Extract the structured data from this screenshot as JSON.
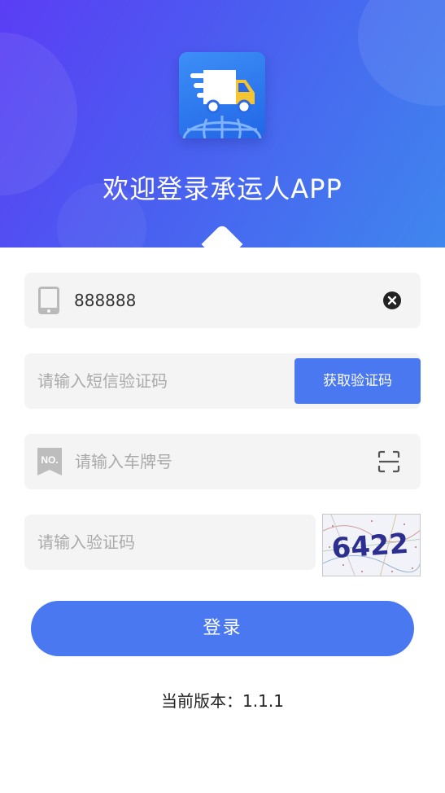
{
  "header": {
    "welcome_title": "欢迎登录承运人APP",
    "app_icon": "truck-globe-icon"
  },
  "form": {
    "phone": {
      "value": "888888",
      "icon": "phone-icon",
      "clear_icon": "clear-icon"
    },
    "sms_code": {
      "placeholder": "请输入短信验证码",
      "button_label": "获取验证码"
    },
    "plate": {
      "placeholder": "请输入车牌号",
      "icon": "plate-no-icon",
      "scan_icon": "scan-icon"
    },
    "captcha": {
      "placeholder": "请输入验证码",
      "image_text": "6422"
    },
    "login_label": "登录"
  },
  "footer": {
    "version_text": "当前版本：1.1.1"
  },
  "colors": {
    "primary": "#4a78f0",
    "header_start": "#5b3df5",
    "header_end": "#3f86ee",
    "field_bg": "#f4f4f4",
    "placeholder": "#aaaaaa"
  }
}
